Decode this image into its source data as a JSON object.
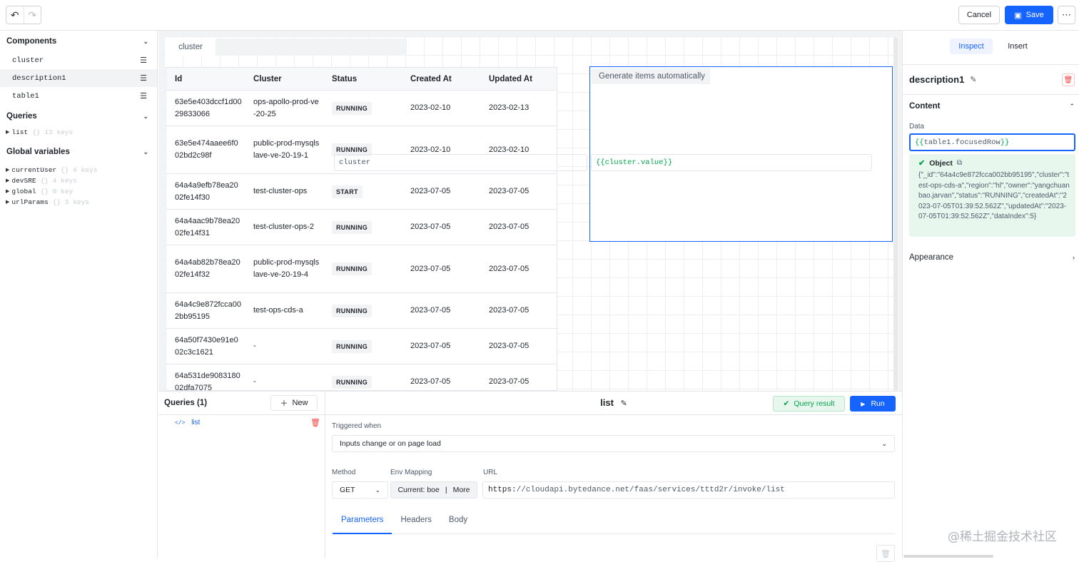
{
  "topbar": {
    "cancel_label": "Cancel",
    "save_label": "Save"
  },
  "left": {
    "components_title": "Components",
    "components": [
      "cluster",
      "description1",
      "table1"
    ],
    "queries_title": "Queries",
    "queries": [
      {
        "name": "list",
        "meta": "{} 13 keys"
      }
    ],
    "globals_title": "Global variables",
    "globals": [
      {
        "name": "currentUser",
        "meta": "{} 6 keys"
      },
      {
        "name": "devSRE",
        "meta": "{} 4 keys"
      },
      {
        "name": "global",
        "meta": "{} 0 key"
      },
      {
        "name": "urlParams",
        "meta": "{} 3 keys"
      }
    ]
  },
  "canvas": {
    "cluster_label": "cluster",
    "generate_label": "Generate items automatically",
    "table": {
      "headers": [
        "Id",
        "Cluster",
        "Status",
        "Created At",
        "Updated At"
      ],
      "rows": [
        [
          "63e5e403dccf1d0029833066",
          "ops-apollo-prod-ve-20-25",
          "RUNNING",
          "2023-02-10",
          "2023-02-13"
        ],
        [
          "63e5e474aaee6f002bd2c98f",
          "public-prod-mysqlslave-ve-20-19-1",
          "RUNNING",
          "2023-02-10",
          "2023-02-10"
        ],
        [
          "64a4a9efb78ea2002fe14f30",
          "test-cluster-ops",
          "START",
          "2023-07-05",
          "2023-07-05"
        ],
        [
          "64a4aac9b78ea2002fe14f31",
          "test-cluster-ops-2",
          "RUNNING",
          "2023-07-05",
          "2023-07-05"
        ],
        [
          "64a4ab82b78ea2002fe14f32",
          "public-prod-mysqlslave-ve-20-19-4",
          "RUNNING",
          "2023-07-05",
          "2023-07-05"
        ],
        [
          "64a4c9e872fcca002bb95195",
          "test-ops-cds-a",
          "RUNNING",
          "2023-07-05",
          "2023-07-05"
        ],
        [
          "64a50f7430e91e002c3c1621",
          "-",
          "RUNNING",
          "2023-07-05",
          "2023-07-05"
        ],
        [
          "64a531de908318002dfa7075",
          "-",
          "RUNNING",
          "2023-07-05",
          "2023-07-05"
        ]
      ]
    }
  },
  "query_panel": {
    "list_title": "Queries (1)",
    "new_label": "New",
    "items": [
      {
        "icon_text": "</>",
        "name": "list"
      }
    ],
    "title": "list",
    "query_result_label": "Query result",
    "run_label": "Run",
    "triggered_label": "Triggered when",
    "triggered_value": "Inputs change or on page load",
    "method_label": "Method",
    "method_value": "GET",
    "env_label": "Env Mapping",
    "env_current": "Current: boe",
    "env_more": "More",
    "url_label": "URL",
    "url_scheme": "https:",
    "url_rest": "//cloudapi.bytedance.net/faas/services/tttd2r/invoke/list",
    "tabs": [
      "Parameters",
      "Headers",
      "Body"
    ],
    "param_key": "cluster",
    "param_value": "{{cluster.value}}"
  },
  "right": {
    "tab_inspect": "Inspect",
    "tab_insert": "Insert",
    "component_name": "description1",
    "content_title": "Content",
    "data_label": "Data",
    "data_open": "{{",
    "data_expr": "table1.focusedRow",
    "data_close": "}}",
    "object_title": "Object",
    "object_value": "{\"_id\":\"64a4c9e872fcca002bb95195\",\"cluster\":\"test-ops-cds-a\",\"region\":\"hl\",\"owner\":\"yangchuanbao.jarvan\",\"status\":\"RUNNING\",\"createdAt\":\"2023-07-05T01:39:52.562Z\",\"updatedAt\":\"2023-07-05T01:39:52.562Z\",\"dataIndex\":5}",
    "appearance_title": "Appearance"
  },
  "watermark": "@稀土掘金技术社区",
  "colors": {
    "primary": "#1664ff",
    "success": "#00a44a",
    "danger": "#f53f3f"
  }
}
